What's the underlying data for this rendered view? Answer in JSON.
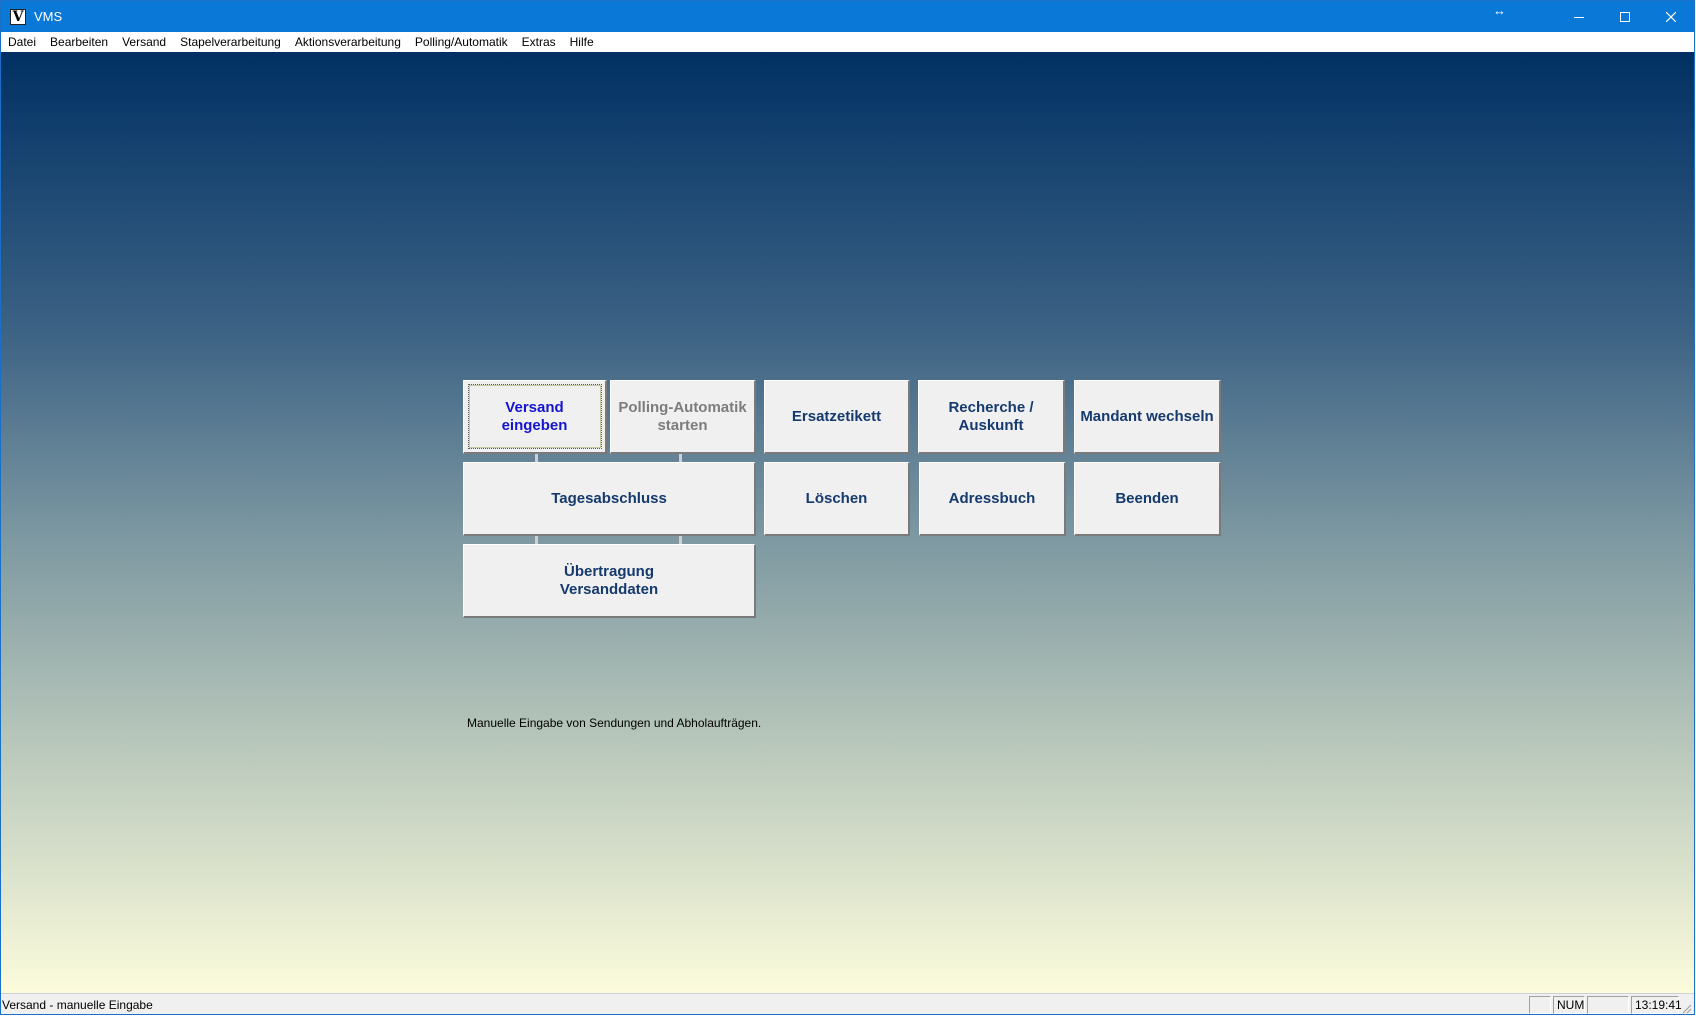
{
  "window": {
    "title": "VMS",
    "resize_hint": "↔"
  },
  "menu": [
    "Datei",
    "Bearbeiten",
    "Versand",
    "Stapelverarbeitung",
    "Aktionsverarbeitung",
    "Polling/Automatik",
    "Extras",
    "Hilfe"
  ],
  "tiles": {
    "versand_eingeben": "Versand\neingeben",
    "polling_starten": "Polling-Automatik\nstarten",
    "ersatzetikett": "Ersatzetikett",
    "recherche": "Recherche /\nAuskunft",
    "mandant_wechseln": "Mandant wechseln",
    "tagesabschluss": "Tagesabschluss",
    "loeschen": "Löschen",
    "adressbuch": "Adressbuch",
    "beenden": "Beenden",
    "uebertragung": "Übertragung\nVersanddaten"
  },
  "description": "Manuelle Eingabe von Sendungen und Abholaufträgen.",
  "status": {
    "text": "Versand - manuelle Eingabe",
    "pane1": "",
    "num": "NUM",
    "pane3": "",
    "time": "13:19:41"
  }
}
